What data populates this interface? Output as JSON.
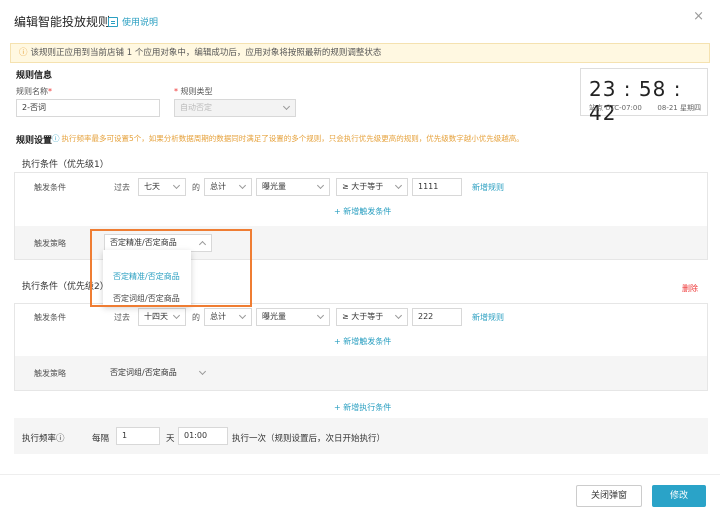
{
  "header": {
    "title": "编辑智能投放规则",
    "help_label": "使用说明",
    "close_glyph": "×"
  },
  "notice": {
    "icon": "warning-icon",
    "text": "该规则正应用到当前店铺 1 个应用对象中，编辑成功后，应用对象将按照最新的规则调整状态"
  },
  "rule_info": {
    "section_title": "规则信息",
    "name_label": "规则名称",
    "name_value": "2-否词",
    "type_label": "规则类型",
    "type_value": "自动否定"
  },
  "clock": {
    "time": "23 : 58 : 42",
    "timezone": "站点 UTC-07:00",
    "date": "08-21 星期四"
  },
  "rule_settings": {
    "section_title": "规则设置",
    "hint": "执行频率最多可设置5个，如果分析数据周期的数据同时满足了设置的多个规则，只会执行优先级更高的规则，优先级数字越小优先级越高。"
  },
  "condition1": {
    "title": "执行条件（优先级1）",
    "trigger_label": "触发条件",
    "past_label": "过去",
    "period": "七天",
    "of_label": "的",
    "agg": "总计",
    "metric": "曝光量",
    "operator": "≥ 大于等于",
    "value": "1111",
    "add_rule_link": "新增规则",
    "add_trigger_link": "+ 新增触发条件",
    "strategy_label": "触发策略",
    "strategy_value": "否定精准/否定商品"
  },
  "strategy_dropdown": {
    "options": [
      "否定精准/否定商品",
      "否定词组/否定商品"
    ]
  },
  "condition2": {
    "title": "执行条件（优先级2）",
    "delete_link": "删除",
    "trigger_label": "触发条件",
    "past_label": "过去",
    "period": "十四天",
    "of_label": "的",
    "agg": "总计",
    "metric": "曝光量",
    "operator": "≥ 大于等于",
    "value": "222",
    "add_rule_link": "新增规则",
    "add_trigger_link": "+ 新增触发条件",
    "strategy_label": "触发策略",
    "strategy_value": "否定词组/否定商品"
  },
  "add_condition_link": "+ 新增执行条件",
  "frequency": {
    "label": "执行频率",
    "every_label": "每隔",
    "days_value": "1",
    "days_unit": "天",
    "time_value": "01:00",
    "suffix": "执行一次（规则设置后，次日开始执行）"
  },
  "footer": {
    "close_button": "关闭弹窗",
    "save_button": "修改"
  },
  "colors": {
    "accent": "#2aa3c8",
    "warning": "#e6a23c",
    "danger": "#e33333",
    "highlight": "#ef7d33"
  }
}
